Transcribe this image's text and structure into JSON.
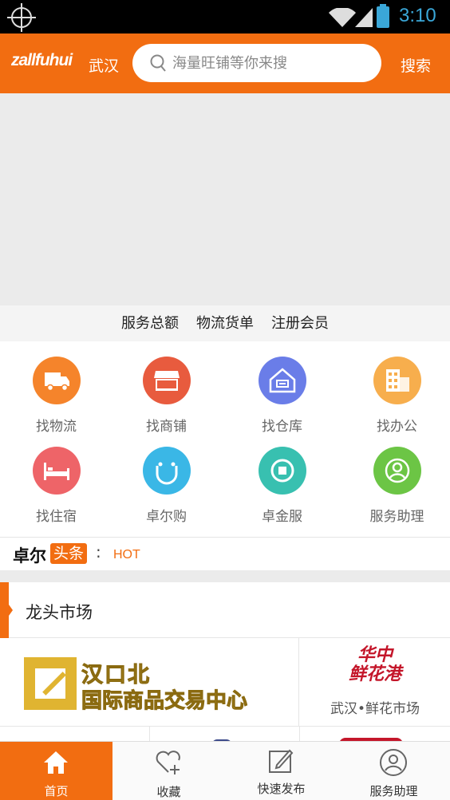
{
  "status_bar": {
    "time": "3:10"
  },
  "header": {
    "logo": "zallfuhui",
    "city": "武汉",
    "search_placeholder": "海量旺铺等你来搜",
    "search_button": "搜索",
    "accent_color": "#f26d11"
  },
  "stats": [
    "服务总额",
    "物流货单",
    "注册会员"
  ],
  "services": [
    {
      "label": "找物流",
      "icon": "truck-icon",
      "color": "#f5842b"
    },
    {
      "label": "找商铺",
      "icon": "shop-icon",
      "color": "#e85b3e"
    },
    {
      "label": "找仓库",
      "icon": "warehouse-icon",
      "color": "#6a7de8"
    },
    {
      "label": "找办公",
      "icon": "office-building-icon",
      "color": "#f7ae4d"
    },
    {
      "label": "找住宿",
      "icon": "bed-icon",
      "color": "#ee6468"
    },
    {
      "label": "卓尔购",
      "icon": "shopping-bag-icon",
      "color": "#3ab7e6"
    },
    {
      "label": "卓金服",
      "icon": "finance-icon",
      "color": "#38c0b0"
    },
    {
      "label": "服务助理",
      "icon": "assistant-icon",
      "color": "#6cc545"
    }
  ],
  "news": {
    "brand": "卓尔",
    "tag": "头条",
    "colon": ":",
    "hot": "HOT"
  },
  "section": {
    "title": "龙头市场"
  },
  "markets": [
    {
      "line1": "汉口北",
      "line2": "国际商品交易中心"
    },
    {
      "logo_line1": "华中",
      "logo_line2": "鲜花港",
      "name": "武汉•鲜花市场"
    }
  ],
  "tabs": [
    {
      "label": "首页",
      "icon": "home-icon",
      "active": true
    },
    {
      "label": "收藏",
      "icon": "heart-plus-icon",
      "active": false
    },
    {
      "label": "快速发布",
      "icon": "edit-icon",
      "active": false
    },
    {
      "label": "服务助理",
      "icon": "user-icon",
      "active": false
    }
  ]
}
